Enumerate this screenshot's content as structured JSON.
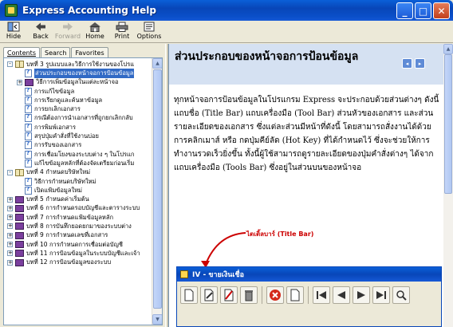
{
  "window": {
    "title": "Express Accounting Help"
  },
  "window_controls": [
    "_",
    "□",
    "✕"
  ],
  "toolbar": {
    "buttons": [
      {
        "label": "Hide",
        "icon": "hide-icon",
        "enabled": true
      },
      {
        "label": "Back",
        "icon": "back-arrow-icon",
        "enabled": true
      },
      {
        "label": "Forward",
        "icon": "forward-arrow-icon",
        "enabled": false
      },
      {
        "label": "Home",
        "icon": "home-icon",
        "enabled": true
      },
      {
        "label": "Print",
        "icon": "printer-icon",
        "enabled": true
      },
      {
        "label": "Options",
        "icon": "options-icon",
        "enabled": true
      }
    ]
  },
  "nav_tabs": [
    {
      "label": "Contents",
      "active": true
    },
    {
      "label": "Search",
      "active": false
    },
    {
      "label": "Favorites",
      "active": false
    }
  ],
  "tree": [
    {
      "level": 0,
      "toggle": "-",
      "icon": "book-open",
      "label": "บทที่ 3 รูปแบบและวิธีการใช้งานของโปรแ"
    },
    {
      "level": 1,
      "toggle": "",
      "icon": "page",
      "label": "ส่วนประกอบของหน้าจอการป้อนข้อมูล",
      "selected": true
    },
    {
      "level": 1,
      "toggle": "+",
      "icon": "book",
      "label": "วิธีการเพิ่มข้อมูลในแต่ละหน้าจอ"
    },
    {
      "level": 1,
      "toggle": "",
      "icon": "page",
      "label": "การแก้ไขข้อมูล"
    },
    {
      "level": 1,
      "toggle": "",
      "icon": "page",
      "label": "การเรียกดูและค้นหาข้อมูล"
    },
    {
      "level": 1,
      "toggle": "",
      "icon": "page",
      "label": "การยกเลิกเอกสาร"
    },
    {
      "level": 1,
      "toggle": "",
      "icon": "page",
      "label": "กรณีต้องการนำเอกสารที่ถูกยกเลิกกลับ"
    },
    {
      "level": 1,
      "toggle": "",
      "icon": "page",
      "label": "การพิมพ์เอกสาร"
    },
    {
      "level": 1,
      "toggle": "",
      "icon": "page",
      "label": "สรุปปุ่มคำสั่งที่ใช้งานบ่อย"
    },
    {
      "level": 1,
      "toggle": "",
      "icon": "page",
      "label": "การรับของเอกสาร"
    },
    {
      "level": 1,
      "toggle": "",
      "icon": "page",
      "label": "การเชื่อมโยงของระบบต่าง ๆ ในโปรแก"
    },
    {
      "level": 1,
      "toggle": "",
      "icon": "page",
      "label": "แก้ไขข้อมูลหลักที่ต้องจัดเตรียมก่อนเริ่ม"
    },
    {
      "level": 0,
      "toggle": "-",
      "icon": "book-open",
      "label": "บทที่ 4 กำหนดบริษัทใหม่"
    },
    {
      "level": 1,
      "toggle": "",
      "icon": "page",
      "label": "วิธีการกำหนดบริษัทใหม่"
    },
    {
      "level": 1,
      "toggle": "",
      "icon": "page",
      "label": "เปิดแฟ้มข้อมูลใหม่"
    },
    {
      "level": 0,
      "toggle": "+",
      "icon": "book",
      "label": "บทที่ 5 กำหนดค่าเริ่มต้น"
    },
    {
      "level": 0,
      "toggle": "+",
      "icon": "book",
      "label": "บทที่ 6 การกำหนดรอบบัญชีและตารางระบบ"
    },
    {
      "level": 0,
      "toggle": "+",
      "icon": "book",
      "label": "บทที่ 7 การกำหนดแฟ้มข้อมูลหลัก"
    },
    {
      "level": 0,
      "toggle": "+",
      "icon": "book",
      "label": "บทที่ 8 การบันทึกยอดยกมาของระบบต่าง"
    },
    {
      "level": 0,
      "toggle": "+",
      "icon": "book",
      "label": "บทที่ 9 การกำหนดเลขที่เอกสาร"
    },
    {
      "level": 0,
      "toggle": "+",
      "icon": "book",
      "label": "บทที่ 10 การกำหนดการเชื่อมต่อบัญชี"
    },
    {
      "level": 0,
      "toggle": "+",
      "icon": "book",
      "label": "บทที่ 11 การป้อนข้อมูลในระบบบัญชีและเจ้า"
    },
    {
      "level": 0,
      "toggle": "+",
      "icon": "book",
      "label": "บทที่ 12 การป้อนข้อมูลของระบบ"
    }
  ],
  "content": {
    "heading": "ส่วนประกอบของหน้าจอการป้อนข้อมูล",
    "paragraph": "ทุกหน้าจอการป้อนข้อมูลในโปรแกรม Express จะประกอบด้วยส่วนต่างๆ ดังนี้ แถบชื่อ (Title Bar) แถบเครื่องมือ (Tool Bar) ส่วนหัวของเอกสาร และส่วนรายละเอียดของเอกสาร ซึ่งแต่ละส่วนมีหน้าที่ดังนี้ โดยสามารถสั่งงานได้ด้วยการคลิกเมาส์ หรือ กดปุ่มคีย์ลัด (Hot Key) ที่ได้กำหนดไว้ ซึ่งจะช่วยให้การทำงานรวดเร็วยิ่งขึ้น ทั้งนี้ผู้ใช้สามารถดูรายละเอียดของปุ่มคำสั่งต่างๆ ได้จากแถบเครื่องมือ (Tools Bar) ซึ่งอยู่ในส่วนบนของหน้าจอ",
    "annotation": "ไตเติ้ลบาร์ (Title Bar)",
    "nav_buttons": [
      "◂",
      "▸"
    ]
  },
  "child_window": {
    "title": "IV - ขายเงินเชื่อ",
    "tools": [
      "new-doc-icon",
      "edit-doc-icon",
      "void-doc-icon",
      "delete-icon",
      "cancel-icon",
      "first-record-icon",
      "prev-record-icon",
      "next-record-icon",
      "last-record-icon",
      "search-icon"
    ]
  },
  "colors": {
    "titlebar": "#0846b8",
    "selection": "#316ac5",
    "annotation": "#cc0000",
    "banner": "#d5e1f2"
  }
}
